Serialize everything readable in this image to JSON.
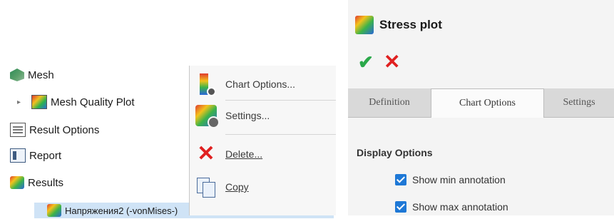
{
  "tree": {
    "mesh_label": "Mesh",
    "mesh_quality_label": "Mesh Quality Plot",
    "result_options_label": "Result Options",
    "report_label": "Report",
    "results_label": "Results",
    "selected_plot_label": "Напряжения2 (-vonMises-)"
  },
  "context_menu": {
    "chart_options": "Chart Options...",
    "settings": "Settings...",
    "delete": "Delete...",
    "copy": "Copy"
  },
  "panel": {
    "title": "Stress plot",
    "tabs": [
      {
        "label": "Definition"
      },
      {
        "label": "Chart Options"
      },
      {
        "label": "Settings"
      }
    ],
    "active_tab": "Chart Options",
    "group_title": "Display Options",
    "checkboxes": [
      {
        "label": "Show min annotation",
        "checked": true
      },
      {
        "label": "Show max annotation",
        "checked": true
      }
    ]
  },
  "colors": {
    "ok": "#2aa84a",
    "cancel": "#e02020",
    "checkbox": "#1e78d6",
    "selection": "#cfe3f6"
  }
}
